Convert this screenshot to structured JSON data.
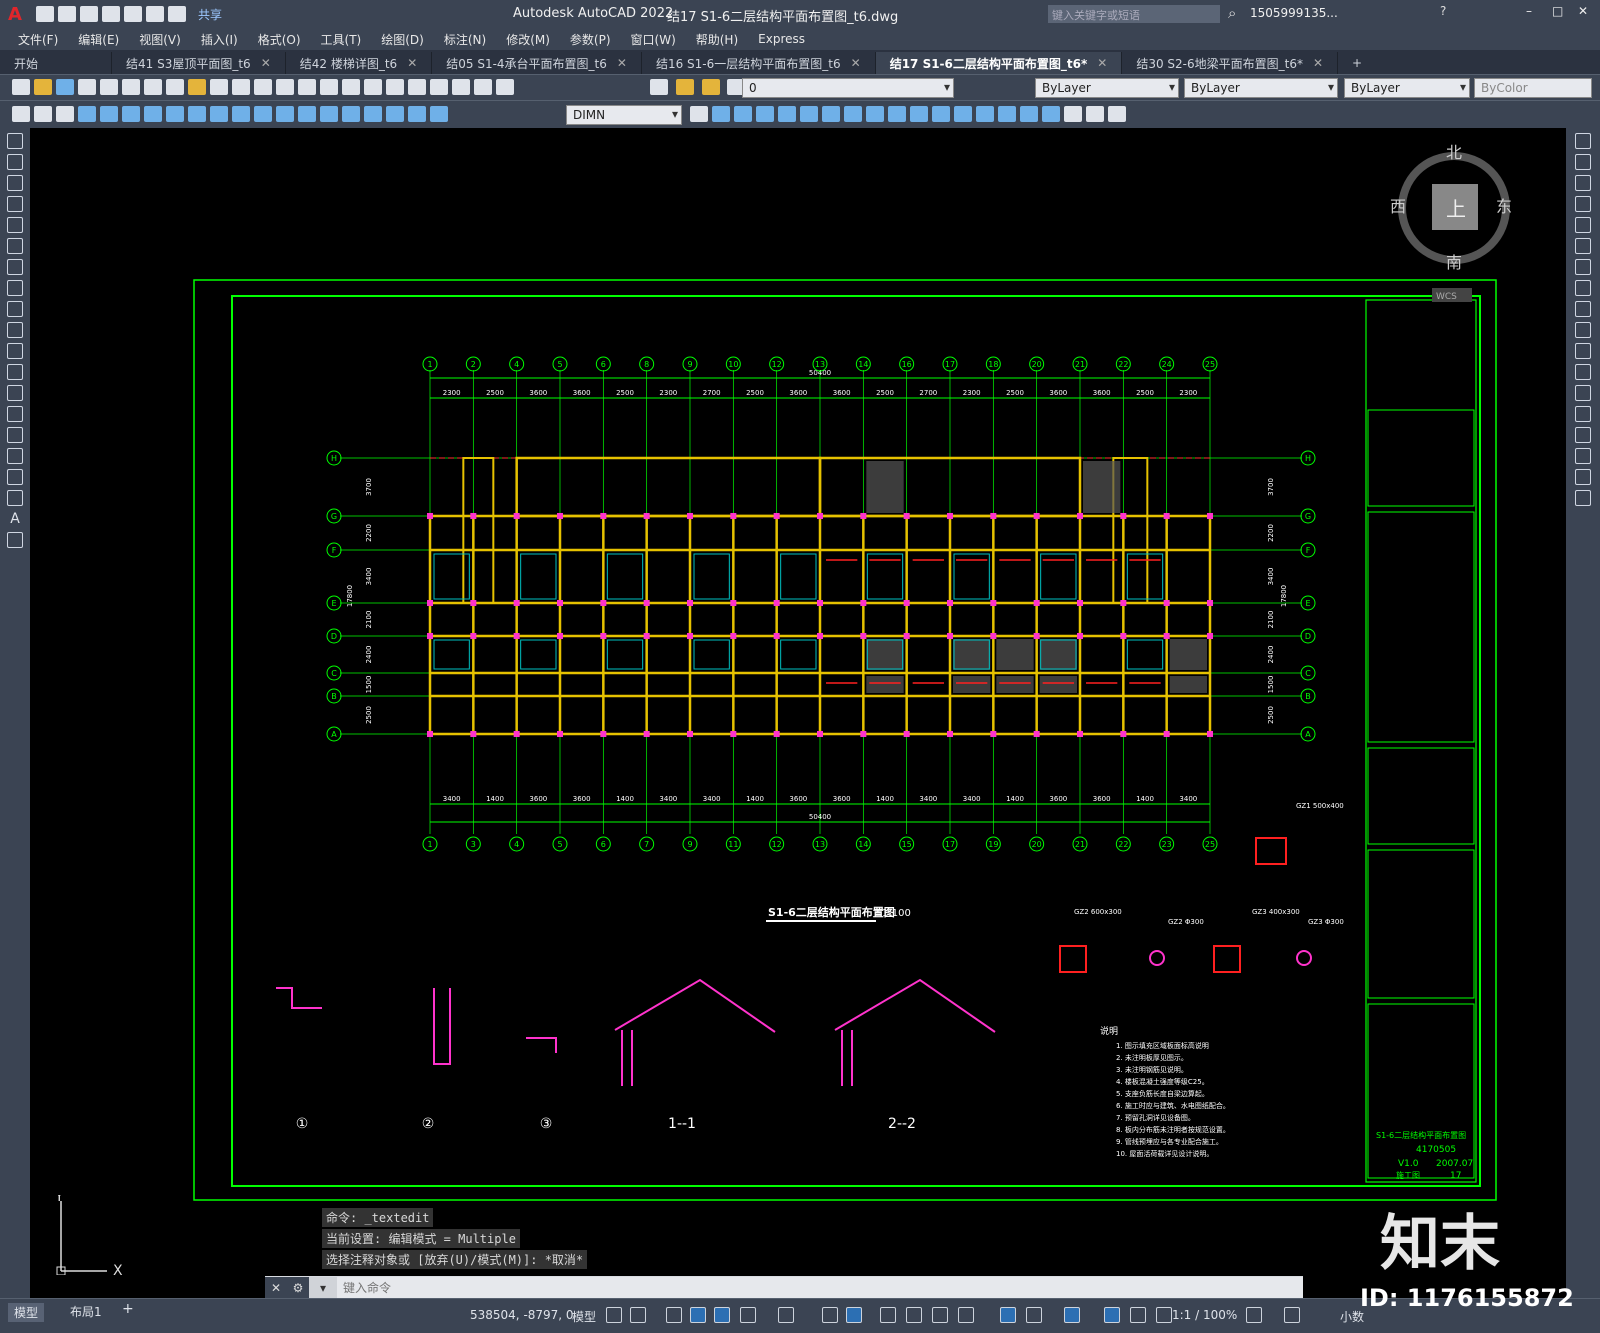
{
  "app": {
    "logo": "A",
    "title": "Autodesk AutoCAD 2022",
    "file": "结17 S1-6二层结构平面布置图_t6.dwg",
    "share": "共享",
    "search_placeholder": "键入关键字或短语",
    "user": "1505999135...",
    "window_controls": [
      "–",
      "□",
      "✕"
    ]
  },
  "menu": [
    "文件(F)",
    "编辑(E)",
    "视图(V)",
    "插入(I)",
    "格式(O)",
    "工具(T)",
    "绘图(D)",
    "标注(N)",
    "修改(M)",
    "参数(P)",
    "窗口(W)",
    "帮助(H)",
    "Express"
  ],
  "tabs": [
    {
      "label": "开始",
      "active": false,
      "closable": false
    },
    {
      "label": "结41 S3屋顶平面图_t6",
      "active": false,
      "closable": true
    },
    {
      "label": "结42 楼梯详图_t6",
      "active": false,
      "closable": true
    },
    {
      "label": "结05 S1-4承台平面布置图_t6",
      "active": false,
      "closable": true
    },
    {
      "label": "结16 S1-6一层结构平面布置图_t6",
      "active": false,
      "closable": true
    },
    {
      "label": "结17 S1-6二层结构平面布置图_t6*",
      "active": true,
      "closable": true
    },
    {
      "label": "结30 S2-6地梁平面布置图_t6*",
      "active": false,
      "closable": true
    }
  ],
  "toolbar": {
    "layer": "0",
    "color": "ByLayer",
    "linetype": "ByLayer",
    "lineweight": "ByLayer",
    "plotstyle": "ByColor",
    "dimstyle": "DIMN"
  },
  "viewcube": {
    "north": "北",
    "south": "南",
    "east": "东",
    "west": "西",
    "face": "上",
    "wcs": "WCS"
  },
  "drawing": {
    "axes_top": [
      "1",
      "2",
      "4",
      "5",
      "6",
      "8",
      "9",
      "10",
      "12",
      "13",
      "14",
      "16",
      "17",
      "18",
      "20",
      "21",
      "22",
      "24",
      "25"
    ],
    "axes_bottom": [
      "1",
      "3",
      "4",
      "5",
      "6",
      "7",
      "9",
      "11",
      "12",
      "13",
      "14",
      "15",
      "17",
      "19",
      "20",
      "21",
      "22",
      "23",
      "25"
    ],
    "axes_rows": [
      "H",
      "G",
      "F",
      "E",
      "D",
      "C",
      "B",
      "A"
    ],
    "dims_top": [
      "2300",
      "2500",
      "3600",
      "3600",
      "2500",
      "2300",
      "2700",
      "2500",
      "3600",
      "3600",
      "2500",
      "2700",
      "2300",
      "2500",
      "3600",
      "3600",
      "2500",
      "2300"
    ],
    "total_dim": "50400",
    "dims_bottom": [
      "3400",
      "1400",
      "3600",
      "3600",
      "1400",
      "3400",
      "3400",
      "1400",
      "3600",
      "3600",
      "1400",
      "3400",
      "3400",
      "1400",
      "3600",
      "3600",
      "1400",
      "3400"
    ],
    "row_dims": [
      "3700",
      "2200",
      "3400",
      "2100",
      "2400",
      "1500",
      "2500"
    ],
    "total_height": "17800",
    "plan_title": "S1-6二层结构平面布置图",
    "plan_scale": "1:100",
    "sections": [
      "①",
      "②",
      "③",
      "1--1",
      "2--2"
    ],
    "column_labels": [
      "GZ1 500x400",
      "GZ2 600x300",
      "GZ2 Φ300",
      "GZ3 400x300",
      "GZ3 Φ300"
    ],
    "notes_title": "说明",
    "notes": [
      "1. 图示填充区域板面标高说明",
      "2. 未注明板厚见图示。",
      "3. 未注明钢筋见说明。",
      "4. 楼板混凝土强度等级C25。",
      "5. 支座负筋长度自梁边算起。",
      "6. 施工时应与建筑、水电图纸配合。",
      "7. 预留孔洞详见设备图。",
      "8. 板内分布筋未注明者按规范设置。",
      "9. 管线预埋应与各专业配合施工。",
      "10. 屋面活荷载详见设计说明。"
    ],
    "titleblock": {
      "drawing_name": "S1-6二层结构平面布置图",
      "contract_no": "4170505",
      "version": "V1.0",
      "date": "2007.07",
      "sheet": "17",
      "stage": "施工图"
    }
  },
  "command": {
    "history": [
      "命令: _textedit",
      "当前设置: 编辑模式 = Multiple",
      "选择注释对象或 [放弃(U)/模式(M)]: *取消*"
    ],
    "placeholder": "键入命令"
  },
  "status": {
    "coords": "538504, -8797, 0",
    "space": "模型",
    "scale": "1:1 / 100%",
    "units": "小数",
    "layouts": [
      "模型",
      "布局1"
    ]
  },
  "watermark": {
    "brand": "知末",
    "id": "ID: 1176155872"
  },
  "colors": {
    "green": "#00ff00",
    "yellow": "#e6c200",
    "cyan": "#00c0c0",
    "magenta": "#ff33cc",
    "red": "#ff2020",
    "white": "#ffffff",
    "chrome": "#3b4453"
  }
}
